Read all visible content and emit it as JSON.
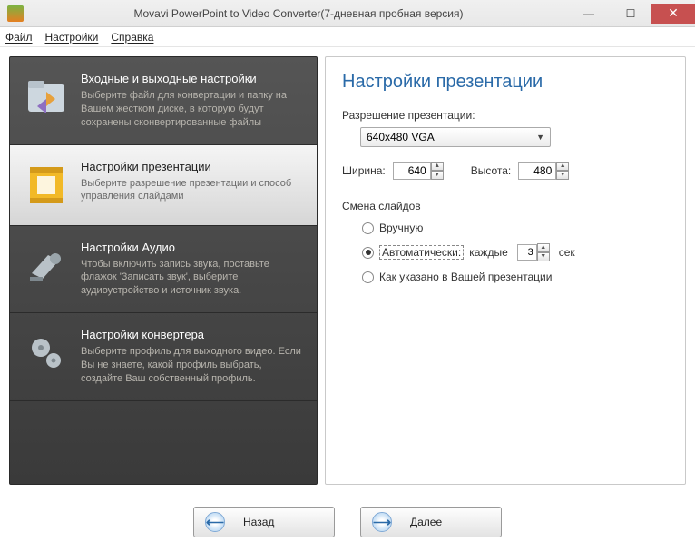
{
  "window": {
    "title": "Movavi PowerPoint to Video Converter(7-дневная пробная версия)"
  },
  "menu": {
    "file": "Файл",
    "settings": "Настройки",
    "help": "Справка"
  },
  "sidebar": {
    "items": [
      {
        "title": "Входные и выходные настройки",
        "desc": "Выберите файл для конвертации и папку на Вашем жестком диске, в которую будут сохранены сконвертированные файлы"
      },
      {
        "title": "Настройки презентации",
        "desc": "Выберите разрешение презентации и способ управления слайдами"
      },
      {
        "title": "Настройки Аудио",
        "desc": "Чтобы включить запись звука, поставьте флажок 'Записать звук', выберите аудиоустройство и источник звука."
      },
      {
        "title": "Настройки конвертера",
        "desc": "Выберите профиль для выходного видео. Если Вы не знаете, какой профиль выбрать, создайте Ваш собственный профиль."
      }
    ]
  },
  "content": {
    "heading": "Настройки презентации",
    "resolution_label": "Разрешение презентации:",
    "resolution_value": "640x480 VGA",
    "width_label": "Ширина:",
    "width_value": "640",
    "height_label": "Высота:",
    "height_value": "480",
    "slide_change_label": "Смена слайдов",
    "radio": {
      "manual": "Вручную",
      "auto": "Автоматически:",
      "auto_every": "каждые",
      "auto_interval": "3",
      "auto_sec": "сек",
      "as_specified": "Как указано в Вашей презентации"
    }
  },
  "nav": {
    "back": "Назад",
    "next": "Далее"
  }
}
